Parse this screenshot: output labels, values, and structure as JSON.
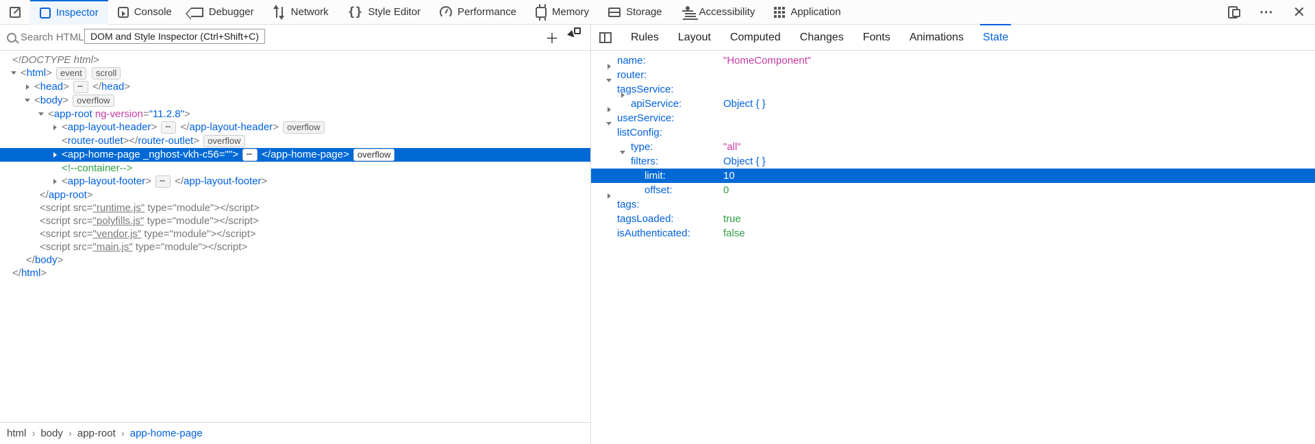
{
  "toolbar": {
    "tabs": [
      "Inspector",
      "Console",
      "Debugger",
      "Network",
      "Style Editor",
      "Performance",
      "Memory",
      "Storage",
      "Accessibility",
      "Application"
    ]
  },
  "search": {
    "placeholder": "Search HTML",
    "tooltip": "DOM and Style Inspector (Ctrl+Shift+C)"
  },
  "dom": {
    "doctype": "<!DOCTYPE html>",
    "html_open": "html",
    "event_badge": "event",
    "scroll_badge": "scroll",
    "head_tag": "head",
    "body_tag": "body",
    "overflow_badge": "overflow",
    "approot_tag": "app-root",
    "approot_attr_name": "ng-version",
    "approot_attr_val": "\"11.2.8\"",
    "layout_header": "app-layout-header",
    "router_outlet": "router-outlet",
    "home_page": "app-home-page",
    "home_attr_name": "_nghost-vkh-c56",
    "home_attr_val": "\"\"",
    "container_comment": "<!--container-->",
    "layout_footer": "app-layout-footer",
    "script_tag": "script",
    "src_attr": "src",
    "type_attr": "type",
    "module_val": "\"module\"",
    "runtime": "\"runtime.js\"",
    "polyfills": "\"polyfills.js\"",
    "vendor": "\"vendor.js\"",
    "main": "\"main.js\""
  },
  "breadcrumbs": [
    "html",
    "body",
    "app-root",
    "app-home-page"
  ],
  "sidebar_tabs": [
    "Rules",
    "Layout",
    "Computed",
    "Changes",
    "Fonts",
    "Animations",
    "State"
  ],
  "props": {
    "name_label": "name:",
    "name_val": "\"HomeComponent\"",
    "router": "router:",
    "tagsService": "tagsService:",
    "apiService": "apiService:",
    "object": "Object {  }",
    "userService": "userService:",
    "listConfig": "listConfig:",
    "type": "type:",
    "type_val": "\"all\"",
    "filters": "filters:",
    "limit": "limit:",
    "limit_val": "10",
    "offset": "offset:",
    "offset_val": "0",
    "tags": "tags:",
    "tagsLoaded": "tagsLoaded:",
    "tagsLoaded_val": "true",
    "isAuth": "isAuthenticated:",
    "isAuth_val": "false"
  }
}
